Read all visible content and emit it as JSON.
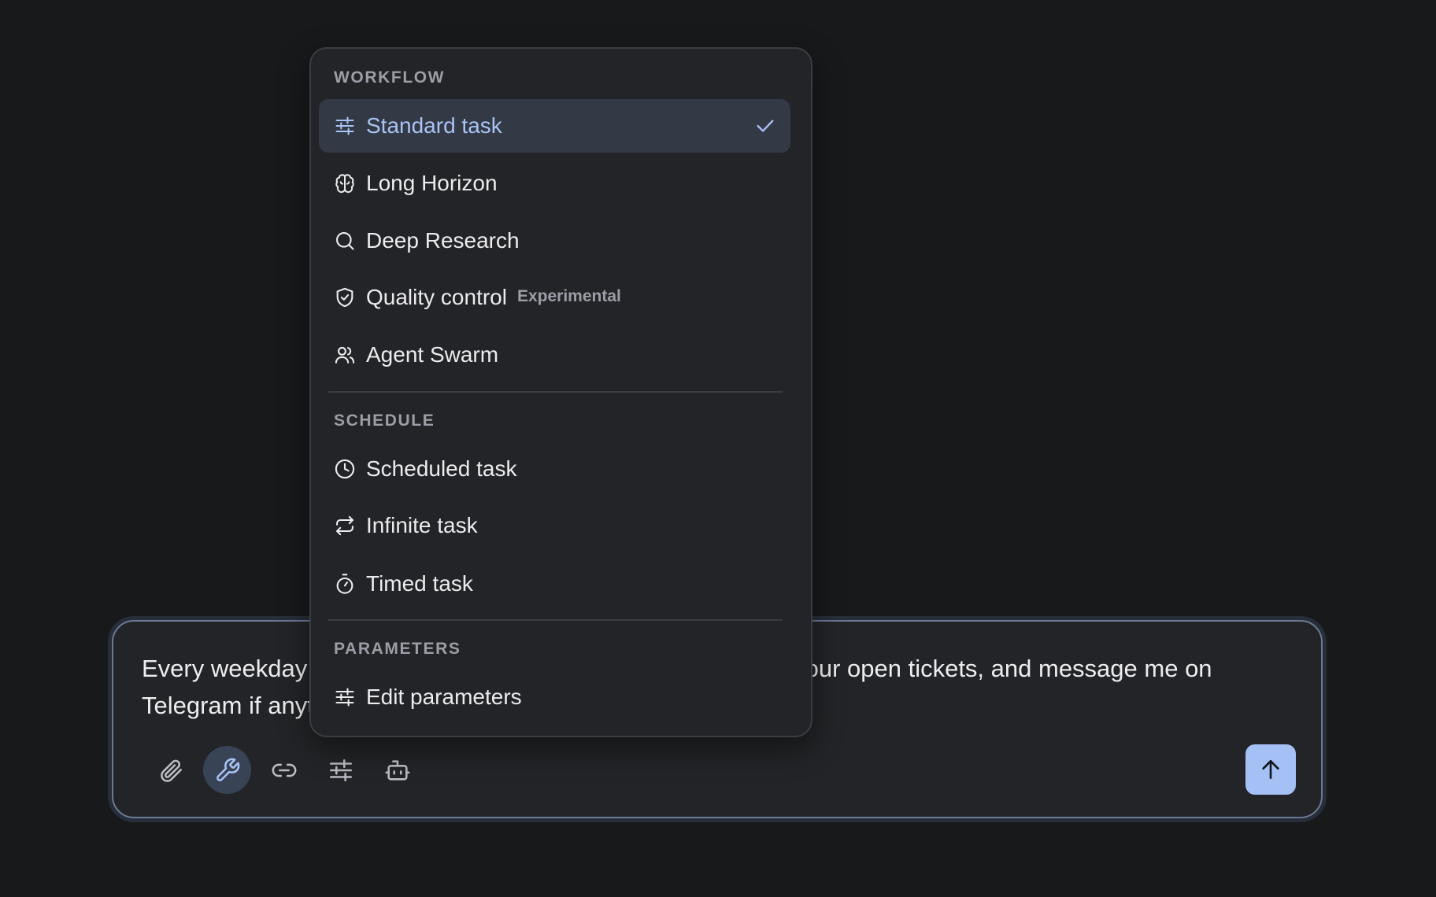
{
  "composer": {
    "text": "Every weekday morning, check the latest support emails and our open tickets, and message me on Telegram if anything needs my attention.",
    "toolbar": {
      "attach_icon": "paperclip-icon",
      "tools_icon": "wrench-icon",
      "link_icon": "link-icon",
      "settings_icon": "sliders-icon",
      "agent_icon": "robot-icon"
    },
    "send_icon": "arrow-up-icon"
  },
  "menu": {
    "workflow": {
      "label": "WORKFLOW",
      "items": [
        {
          "label": "Standard task",
          "icon": "sliders-icon",
          "selected": true
        },
        {
          "label": "Long Horizon",
          "icon": "brain-icon"
        },
        {
          "label": "Deep Research",
          "icon": "search-icon"
        },
        {
          "label": "Quality control",
          "icon": "shield-check-icon",
          "badge": "Experimental"
        },
        {
          "label": "Agent Swarm",
          "icon": "users-icon"
        }
      ]
    },
    "schedule": {
      "label": "SCHEDULE",
      "items": [
        {
          "label": "Scheduled task",
          "icon": "clock-icon"
        },
        {
          "label": "Infinite task",
          "icon": "repeat-icon"
        },
        {
          "label": "Timed task",
          "icon": "timer-icon"
        }
      ]
    },
    "parameters": {
      "label": "PARAMETERS",
      "items": [
        {
          "label": "Edit parameters",
          "icon": "sliders-icon"
        }
      ]
    }
  },
  "colors": {
    "background": "#18191b",
    "panel": "#232427",
    "accent": "#a9c3f5",
    "send_button": "#a4c0f4",
    "selected_bg": "#333945"
  }
}
